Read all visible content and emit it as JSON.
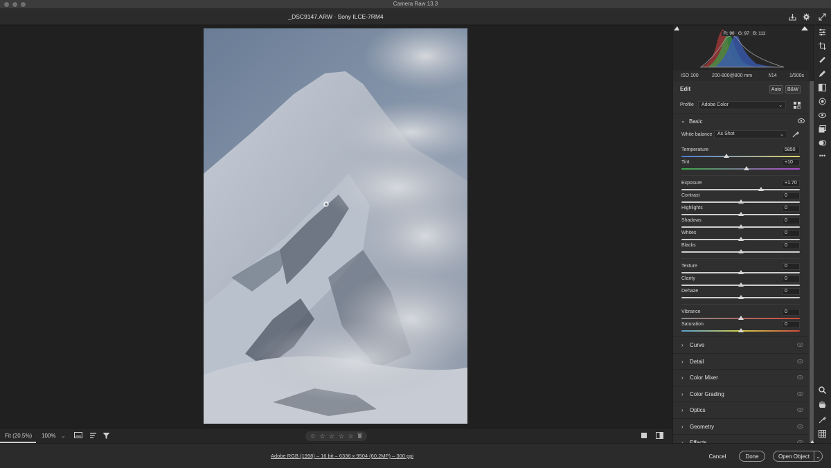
{
  "window": {
    "title": "Camera Raw 13.3"
  },
  "header": {
    "filename": "_DSC9147.ARW  ·  Sony ILCE-7RM4"
  },
  "histogram": {
    "r_label": "R:",
    "r_value": "90",
    "g_label": "G:",
    "g_value": "97",
    "b_label": "B:",
    "b_value": "111"
  },
  "exif": {
    "iso": "ISO 100",
    "lens": "200-800@800 mm",
    "aperture": "f/14",
    "shutter": "1/500s"
  },
  "edit": {
    "title": "Edit",
    "auto_label": "Auto",
    "bw_label": "B&W",
    "profile_label": "Profile",
    "profile_value": "Adobe Color"
  },
  "basic": {
    "title": "Basic",
    "white_balance_label": "White balance",
    "white_balance_value": "As Shot",
    "sliders": [
      {
        "label": "Temperature",
        "value": "5850",
        "fraction": 0.38,
        "track": "temp"
      },
      {
        "label": "Tint",
        "value": "+10",
        "fraction": 0.55,
        "track": "tint"
      },
      {
        "label": "Exposure",
        "value": "+1.70",
        "fraction": 0.67,
        "track": "plain"
      },
      {
        "label": "Contrast",
        "value": "0",
        "fraction": 0.5,
        "track": "plain"
      },
      {
        "label": "Highlights",
        "value": "0",
        "fraction": 0.5,
        "track": "plain"
      },
      {
        "label": "Shadows",
        "value": "0",
        "fraction": 0.5,
        "track": "plain"
      },
      {
        "label": "Whites",
        "value": "0",
        "fraction": 0.5,
        "track": "plain"
      },
      {
        "label": "Blacks",
        "value": "0",
        "fraction": 0.5,
        "track": "plain"
      },
      {
        "label": "Texture",
        "value": "0",
        "fraction": 0.5,
        "track": "plain"
      },
      {
        "label": "Clarity",
        "value": "0",
        "fraction": 0.5,
        "track": "plain"
      },
      {
        "label": "Dehaze",
        "value": "0",
        "fraction": 0.5,
        "track": "plain"
      },
      {
        "label": "Vibrance",
        "value": "0",
        "fraction": 0.5,
        "track": "vib"
      },
      {
        "label": "Saturation",
        "value": "0",
        "fraction": 0.5,
        "track": "sat"
      }
    ]
  },
  "panels": [
    "Curve",
    "Detail",
    "Color Mixer",
    "Color Grading",
    "Optics",
    "Geometry",
    "Effects"
  ],
  "toolbar": {
    "fit_label": "Fit (20.5%)",
    "zoom_label": "100%",
    "rating": "☆ ☆ ☆ ☆ ☆"
  },
  "footer": {
    "info": "Adobe RGB (1998) – 16 bit – 6336 x 9504 (60.2MP) – 300 ppi",
    "cancel": "Cancel",
    "done": "Done",
    "open": "Open Object"
  },
  "colors": {
    "accent": "#4a90e2",
    "panel": "#2f2f2f",
    "background": "#1e1e1e"
  }
}
